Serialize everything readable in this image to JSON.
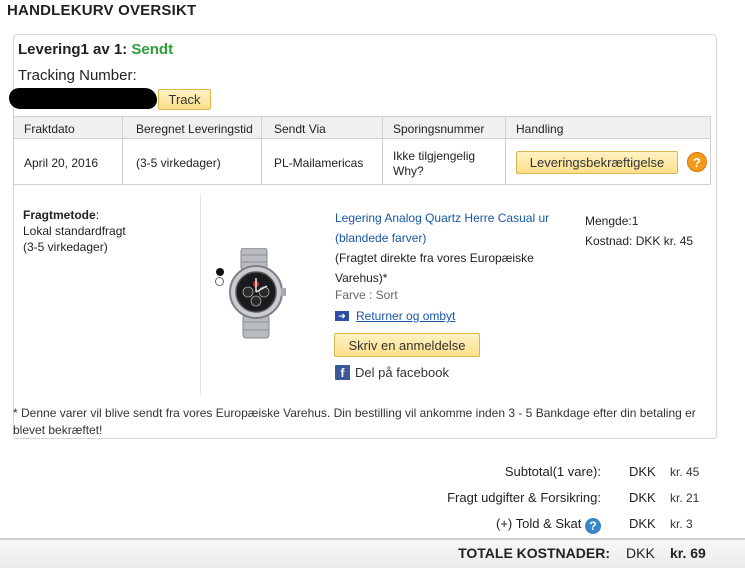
{
  "page": {
    "title": "HANDLEKURV OVERSIKT"
  },
  "delivery": {
    "heading": "Levering1 av 1:",
    "status": "Sendt",
    "tracking_label": "Tracking Number:",
    "track_button": "Track"
  },
  "shipping_table": {
    "headers": [
      "Fraktdato",
      "Beregnet Leveringstid",
      "Sendt Via",
      "Sporingsnummer",
      "Handling"
    ],
    "row": {
      "date": "April 20, 2016",
      "estimate": "(3-5 virkedager)",
      "carrier": "PL-Mailamericas",
      "tracking_status": "Ikke tilgjengelig",
      "tracking_why": "Why?",
      "action_button": "Leveringsbekræftigelse",
      "help_icon_text": "?"
    }
  },
  "freight": {
    "label": "Fragtmetode",
    "method": "Lokal standardfragt",
    "estimate": "(3-5 virkedager)"
  },
  "product": {
    "image_icon": "watch-image",
    "title": "Legering Analog Quartz Herre Casual ur (blandede farver)",
    "note": "(Fragtet direkte fra vores Europæiske Varehus)*",
    "color": "Farve : Sort",
    "returns_link": "Returner og ombyt",
    "review_button": "Skriv en anmeldelse",
    "facebook": "Del på facebook",
    "quantity": "Mengde:1",
    "cost": "Kostnad: DKK kr. 45"
  },
  "footnote": "* Denne varer vil blive sendt fra vores Europæiske Varehus. Din bestilling vil ankomme inden 3 - 5 Bankdage efter din betaling er blevet bekræftet!",
  "totals": {
    "subtotal": {
      "label": "Subtotal(1 vare):",
      "currency": "DKK",
      "amount": "kr. 45"
    },
    "freight": {
      "label": "Fragt udgifter & Forsikring:",
      "currency": "DKK",
      "amount": "kr. 21"
    },
    "tax": {
      "label": "(+) Told & Skat",
      "currency": "DKK",
      "amount": "kr. 3"
    },
    "grand": {
      "label": "TOTALE KOSTNADER:",
      "currency": "DKK",
      "amount": "kr. 69"
    }
  },
  "colors": {
    "status_green": "#2e9e3a",
    "link_blue": "#1a57a8",
    "button_yellow": "#fbdf8a",
    "help_orange": "#f29a1c"
  }
}
